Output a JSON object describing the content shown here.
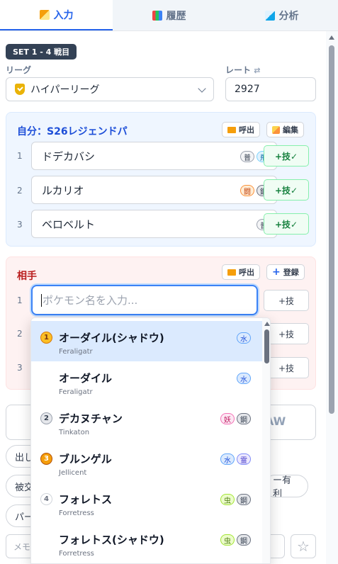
{
  "tabs": [
    {
      "label": "入力",
      "icon": "edit-icon",
      "active": true
    },
    {
      "label": "履歴",
      "icon": "bar-chart-icon",
      "active": false
    },
    {
      "label": "分析",
      "icon": "line-chart-icon",
      "active": false
    }
  ],
  "set_badge": "SET 1 - 4 戦目",
  "league": {
    "label": "リーグ",
    "value": "ハイパーリーグ"
  },
  "rate": {
    "label": "レート",
    "value": "2927"
  },
  "self": {
    "title": "自分：S26レジェンドパ",
    "load_label": "呼出",
    "edit_label": "編集",
    "rows": [
      {
        "num": "1",
        "name": "ドデカバシ",
        "types": [
          "普",
          "飛"
        ],
        "tech": "+技✓"
      },
      {
        "num": "2",
        "name": "ルカリオ",
        "types": [
          "闘",
          "鋼"
        ],
        "tech": "+技✓"
      },
      {
        "num": "3",
        "name": "ベロベルト",
        "types": [
          "普"
        ],
        "tech": "+技✓"
      }
    ]
  },
  "opponent": {
    "title": "相手",
    "load_label": "呼出",
    "register_label": "登録",
    "rows": [
      {
        "num": "1",
        "placeholder": "ポケモン名を入力...",
        "tech": "+技"
      },
      {
        "num": "2",
        "tech": "+技"
      },
      {
        "num": "3",
        "tech": "+技"
      }
    ]
  },
  "result": {
    "draw_label": "AW"
  },
  "chips": {
    "a": "出し",
    "b": "被交",
    "c": "パー",
    "d": "ー有利"
  },
  "memo": {
    "placeholder": "メモ"
  },
  "suggestions": [
    {
      "rank": "1",
      "name": "オーダイル(シャドウ)",
      "en": "Feraligatr",
      "types": [
        "水"
      ],
      "selected": true
    },
    {
      "rank": "",
      "name": "オーダイル",
      "en": "Feraligatr",
      "types": [
        "水"
      ],
      "selected": false
    },
    {
      "rank": "2",
      "name": "デカヌチャン",
      "en": "Tinkaton",
      "types": [
        "妖",
        "鋼"
      ],
      "selected": false
    },
    {
      "rank": "3",
      "name": "ブルンゲル",
      "en": "Jellicent",
      "types": [
        "水",
        "霊"
      ],
      "selected": false
    },
    {
      "rank": "4",
      "name": "フォレトス",
      "en": "Forretress",
      "types": [
        "虫",
        "鋼"
      ],
      "selected": false
    },
    {
      "rank": "",
      "name": "フォレトス(シャドウ)",
      "en": "Forretress",
      "types": [
        "虫",
        "鋼"
      ],
      "selected": false
    }
  ]
}
